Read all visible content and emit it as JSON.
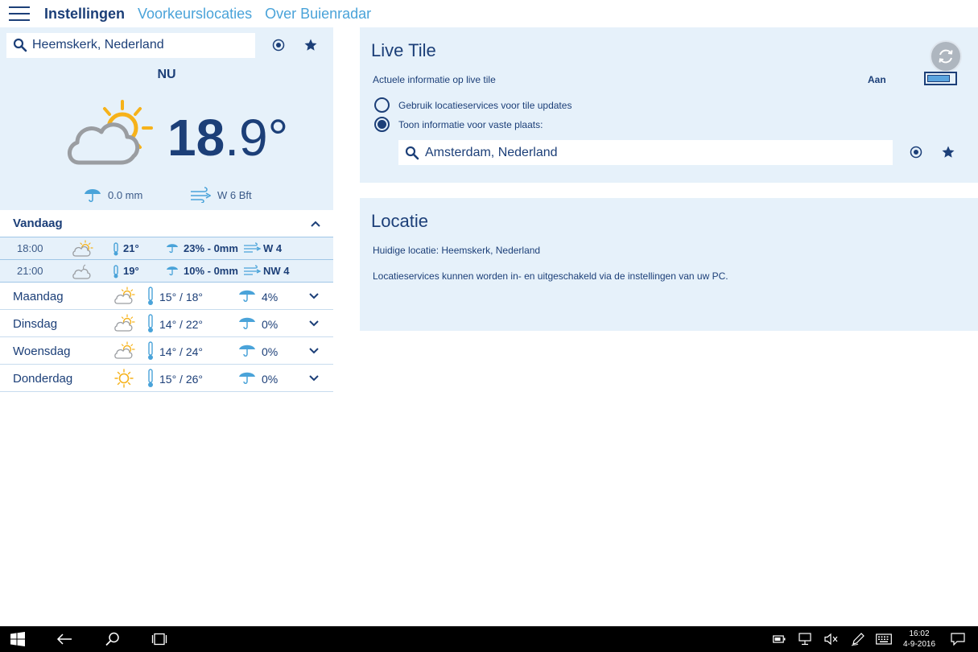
{
  "nav": {
    "tabs": [
      {
        "label": "Instellingen",
        "active": true
      },
      {
        "label": "Voorkeurslocaties",
        "active": false
      },
      {
        "label": "Over Buienradar",
        "active": false
      }
    ]
  },
  "current": {
    "location": "Heemskerk, Nederland",
    "now_label": "NU",
    "temp_int": "18",
    "temp_dec": ".9°",
    "precipitation": "0.0 mm",
    "wind": "W 6 Bft",
    "icon": "partly-cloudy-icon"
  },
  "today": {
    "label": "Vandaag",
    "hours": [
      {
        "time": "18:00",
        "icon": "partly-cloudy-icon",
        "temp": "21°",
        "precip": "23%  -  0mm",
        "wind": "W 4"
      },
      {
        "time": "21:00",
        "icon": "cloudy-night-icon",
        "temp": "19°",
        "precip": "10%  -  0mm",
        "wind": "NW 4"
      }
    ]
  },
  "days": [
    {
      "name": "Maandag",
      "icon": "partly-cloudy-icon",
      "temp": "15°  /  18°",
      "precip": "4%"
    },
    {
      "name": "Dinsdag",
      "icon": "partly-cloudy-icon",
      "temp": "14°  /  22°",
      "precip": "0%"
    },
    {
      "name": "Woensdag",
      "icon": "partly-cloudy-icon",
      "temp": "14°  /  24°",
      "precip": "0%"
    },
    {
      "name": "Donderdag",
      "icon": "sun-icon",
      "temp": "15°  /  26°",
      "precip": "0%"
    }
  ],
  "live_tile": {
    "title": "Live Tile",
    "info_label": "Actuele informatie op live tile",
    "toggle_label": "Aan",
    "toggle_on": true,
    "radio1_label": "Gebruik locatieservices voor tile updates",
    "radio2_label": "Toon informatie voor vaste plaats:",
    "selected_radio": 2,
    "fixed_location": "Amsterdam, Nederland"
  },
  "locatie": {
    "title": "Locatie",
    "current_location": "Huidige locatie: Heemskerk, Nederland",
    "services_note": "Locatieservices kunnen worden in- en uitgeschakeld via de instellingen van uw PC."
  },
  "taskbar": {
    "time": "16:02",
    "date": "4-9-2016"
  },
  "colors": {
    "primary": "#1c3f78",
    "accent": "#4aa3d9",
    "panel_bg": "#e6f1fa",
    "sun": "#f6b21a",
    "cloud": "#9a9da1"
  }
}
